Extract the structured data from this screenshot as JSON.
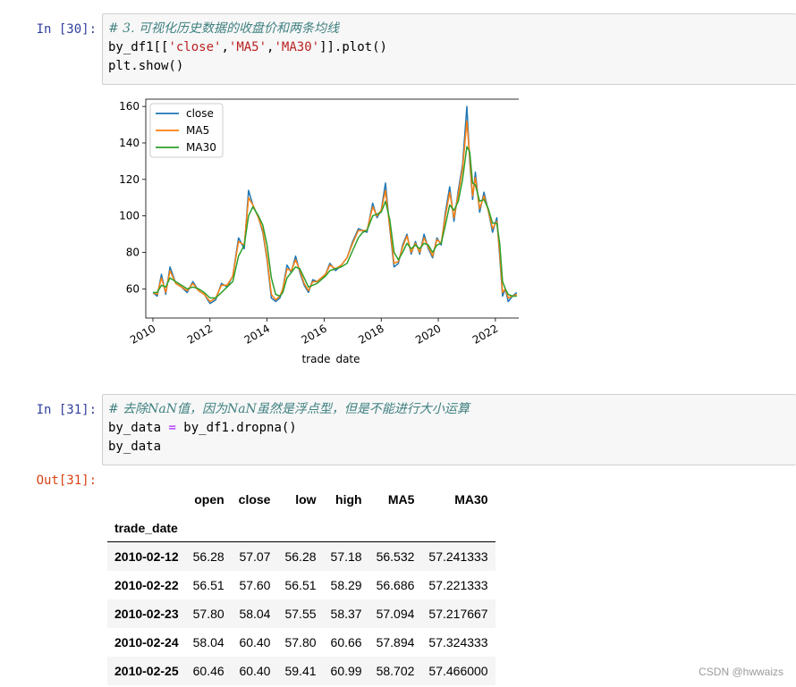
{
  "cells": [
    {
      "prompt": "In  [30]:",
      "code_lines": [
        [
          {
            "t": "# 3. 可视化历史数据的收盘价和两条均线",
            "c": "cm-comment"
          }
        ],
        [
          {
            "t": "by_df1[[",
            "c": ""
          },
          {
            "t": "'close'",
            "c": "cm-string"
          },
          {
            "t": ",",
            "c": ""
          },
          {
            "t": "'MA5'",
            "c": "cm-string"
          },
          {
            "t": ",",
            "c": ""
          },
          {
            "t": "'MA30'",
            "c": "cm-string"
          },
          {
            "t": "]].plot()",
            "c": ""
          }
        ],
        [
          {
            "t": "plt.show()",
            "c": ""
          }
        ]
      ]
    },
    {
      "prompt": "In  [31]:",
      "code_lines": [
        [
          {
            "t": "# 去除NaN值，因为NaN虽然是浮点型，但是不能进行大小运算",
            "c": "cm-comment"
          }
        ],
        [
          {
            "t": "by_data ",
            "c": ""
          },
          {
            "t": "=",
            "c": "cm-op"
          },
          {
            "t": " by_df1.dropna()",
            "c": ""
          }
        ],
        [
          {
            "t": "by_data",
            "c": ""
          }
        ]
      ]
    }
  ],
  "output_prompt": "Out[31]:",
  "chart_data": {
    "type": "line",
    "xlabel": "trade_date",
    "ylabel": "",
    "xlim": [
      2009.75,
      2022.85
    ],
    "ylim": [
      44,
      164
    ],
    "xticks": [
      2010,
      2012,
      2014,
      2016,
      2018,
      2020,
      2022
    ],
    "yticks": [
      60,
      80,
      100,
      120,
      140,
      160
    ],
    "legend_position": "top-left",
    "colors": {
      "close": "#1f77b4",
      "MA5": "#ff7f0e",
      "MA30": "#2ca02c"
    },
    "x": [
      2010.0,
      2010.15,
      2010.3,
      2010.45,
      2010.6,
      2010.8,
      2011.0,
      2011.2,
      2011.4,
      2011.6,
      2011.8,
      2012.0,
      2012.2,
      2012.4,
      2012.6,
      2012.8,
      2013.0,
      2013.2,
      2013.35,
      2013.5,
      2013.7,
      2013.85,
      2014.0,
      2014.15,
      2014.3,
      2014.45,
      2014.55,
      2014.7,
      2014.85,
      2015.0,
      2015.15,
      2015.3,
      2015.45,
      2015.6,
      2015.75,
      2015.9,
      2016.05,
      2016.2,
      2016.4,
      2016.6,
      2016.8,
      2017.0,
      2017.2,
      2017.35,
      2017.5,
      2017.7,
      2017.85,
      2018.0,
      2018.15,
      2018.3,
      2018.45,
      2018.6,
      2018.75,
      2018.9,
      2019.05,
      2019.2,
      2019.35,
      2019.5,
      2019.65,
      2019.8,
      2019.95,
      2020.1,
      2020.25,
      2020.4,
      2020.55,
      2020.7,
      2020.85,
      2021.0,
      2021.1,
      2021.2,
      2021.3,
      2021.45,
      2021.6,
      2021.75,
      2021.9,
      2022.05,
      2022.15,
      2022.25,
      2022.35,
      2022.45,
      2022.6,
      2022.75
    ],
    "series": [
      {
        "name": "close",
        "values": [
          58,
          56,
          68,
          57,
          72,
          63,
          61,
          58,
          64,
          59,
          57,
          52,
          54,
          63,
          61,
          67,
          88,
          82,
          114,
          106,
          99,
          91,
          76,
          55,
          53,
          55,
          60,
          73,
          69,
          78,
          69,
          62,
          58,
          65,
          64,
          66,
          68,
          74,
          70,
          73,
          77,
          86,
          93,
          92,
          91,
          107,
          99,
          103,
          118,
          93,
          72,
          74,
          84,
          90,
          79,
          86,
          79,
          90,
          82,
          77,
          88,
          84,
          102,
          116,
          97,
          114,
          128,
          160,
          130,
          109,
          124,
          102,
          113,
          103,
          91,
          99,
          78,
          56,
          60,
          53,
          56,
          58
        ]
      },
      {
        "name": "MA5",
        "values": [
          58,
          57,
          66,
          58,
          70,
          63,
          61,
          59,
          63,
          59,
          57,
          53,
          55,
          62,
          62,
          67,
          86,
          84,
          110,
          106,
          99,
          92,
          77,
          57,
          54,
          56,
          60,
          71,
          70,
          76,
          70,
          63,
          59,
          64,
          64,
          66,
          68,
          73,
          71,
          73,
          77,
          85,
          92,
          92,
          92,
          105,
          100,
          103,
          114,
          94,
          74,
          75,
          83,
          89,
          80,
          85,
          80,
          88,
          83,
          78,
          87,
          85,
          100,
          113,
          99,
          112,
          126,
          152,
          132,
          111,
          121,
          104,
          111,
          103,
          93,
          97,
          80,
          58,
          60,
          55,
          56,
          57
        ]
      },
      {
        "name": "MA30",
        "values": [
          58,
          58,
          62,
          61,
          66,
          64,
          62,
          60,
          61,
          60,
          58,
          55,
          55,
          58,
          61,
          64,
          78,
          84,
          100,
          105,
          100,
          95,
          84,
          66,
          57,
          56,
          58,
          66,
          69,
          72,
          71,
          66,
          61,
          62,
          63,
          65,
          67,
          70,
          71,
          72,
          74,
          81,
          88,
          91,
          92,
          100,
          101,
          102,
          108,
          98,
          80,
          76,
          80,
          85,
          82,
          84,
          82,
          85,
          84,
          80,
          84,
          85,
          95,
          106,
          103,
          108,
          120,
          138,
          135,
          118,
          117,
          108,
          109,
          104,
          96,
          96,
          85,
          64,
          60,
          57,
          56,
          56
        ]
      }
    ]
  },
  "table": {
    "columns": [
      "open",
      "close",
      "low",
      "high",
      "MA5",
      "MA30"
    ],
    "index_name": "trade_date",
    "rows": [
      {
        "index": "2010-02-12",
        "cells": [
          "56.28",
          "57.07",
          "56.28",
          "57.18",
          "56.532",
          "57.241333"
        ]
      },
      {
        "index": "2010-02-22",
        "cells": [
          "56.51",
          "57.60",
          "56.51",
          "58.29",
          "56.686",
          "57.221333"
        ]
      },
      {
        "index": "2010-02-23",
        "cells": [
          "57.80",
          "58.04",
          "57.55",
          "58.37",
          "57.094",
          "57.217667"
        ]
      },
      {
        "index": "2010-02-24",
        "cells": [
          "58.04",
          "60.40",
          "57.80",
          "60.66",
          "57.894",
          "57.324333"
        ]
      },
      {
        "index": "2010-02-25",
        "cells": [
          "60.46",
          "60.40",
          "59.41",
          "60.99",
          "58.702",
          "57.466000"
        ]
      }
    ]
  },
  "watermark": "CSDN @hwwaizs"
}
